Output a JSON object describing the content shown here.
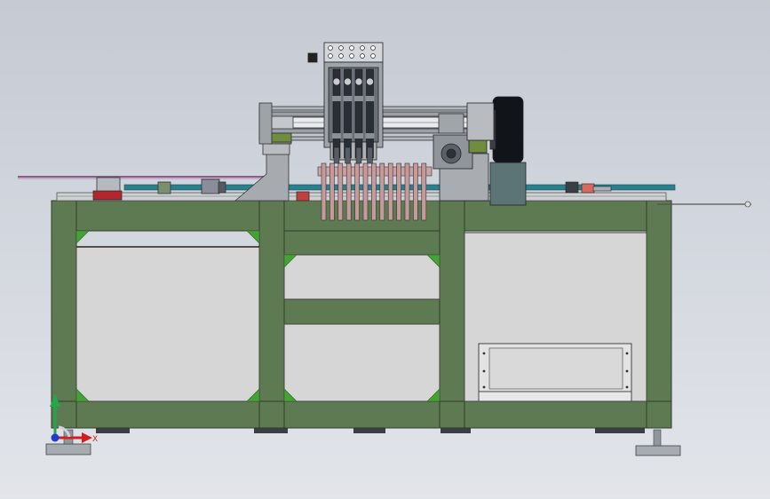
{
  "view": {
    "background_top": "#c5cad3",
    "background_bottom": "#e2e5ea"
  },
  "colors": {
    "frame_green": "#5e7a52",
    "frame_dark": "#2e3d28",
    "panel_gray": "#d6d6d6",
    "gusset_green": "#46a236",
    "table_top": "#ced2d4",
    "steel": "#a9adb2",
    "slate": "#5d7477",
    "pink_plate": "#c69a9a",
    "red_block": "#b3262d",
    "teal_rod": "#2c7f8c",
    "foot": "#9aa0a6"
  },
  "triad": {
    "y_label": "Y",
    "x_label": "X",
    "y_color": "#22a84a",
    "x_color": "#d21e1e",
    "z_color": "#1e3cd2"
  }
}
